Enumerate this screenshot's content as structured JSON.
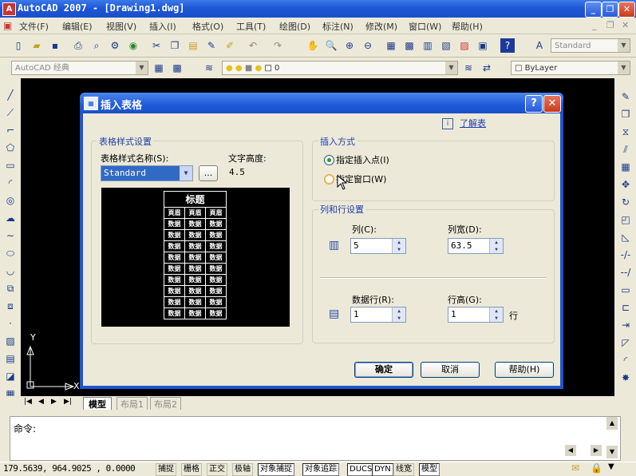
{
  "window": {
    "title": "AutoCAD 2007 - [Drawing1.dwg]"
  },
  "menu": [
    "文件(F)",
    "编辑(E)",
    "视图(V)",
    "插入(I)",
    "格式(O)",
    "工具(T)",
    "绘图(D)",
    "标注(N)",
    "修改(M)",
    "窗口(W)",
    "帮助(H)"
  ],
  "toolbar": {
    "workspace": "AutoCAD 经典",
    "text_style": "Standard",
    "layer": "0",
    "color": "ByLayer"
  },
  "dialog": {
    "title": "插入表格",
    "learn_more": "了解表",
    "style_group": "表格样式设置",
    "style_name_label": "表格样式名称(S):",
    "style_name_value": "Standard",
    "browse_label": "...",
    "text_height_label": "文字高度:",
    "text_height_value": "4.5",
    "preview": {
      "title": "标题",
      "header": [
        "頁眉",
        "頁眉",
        "頁眉"
      ],
      "data_cell": "数据",
      "data_rows": 9
    },
    "insert_group": "插入方式",
    "insert_options": [
      {
        "label": "指定插入点(I)",
        "selected": true
      },
      {
        "label": "指定窗口(W)",
        "selected": false
      }
    ],
    "rowcol_group": "列和行设置",
    "columns_label": "列(C):",
    "columns_value": "5",
    "col_width_label": "列宽(D):",
    "col_width_value": "63.5",
    "data_rows_label": "数据行(R):",
    "data_rows_value": "1",
    "row_height_label": "行高(G):",
    "row_height_value": "1",
    "row_unit": "行",
    "ok": "确定",
    "cancel": "取消",
    "help": "帮助(H)"
  },
  "canvas": {
    "y_axis": "Y",
    "x_axis": "X"
  },
  "layout_tabs": [
    "模型",
    "布局1",
    "布局2"
  ],
  "command": {
    "prompt": "命令:"
  },
  "status": {
    "coords": "179.5639, 964.9025 , 0.0000",
    "toggles": [
      "捕捉",
      "栅格",
      "正交",
      "极轴",
      "对象捕捉",
      "对象追踪",
      "DUCS",
      "DYN",
      "线宽",
      "模型"
    ]
  }
}
